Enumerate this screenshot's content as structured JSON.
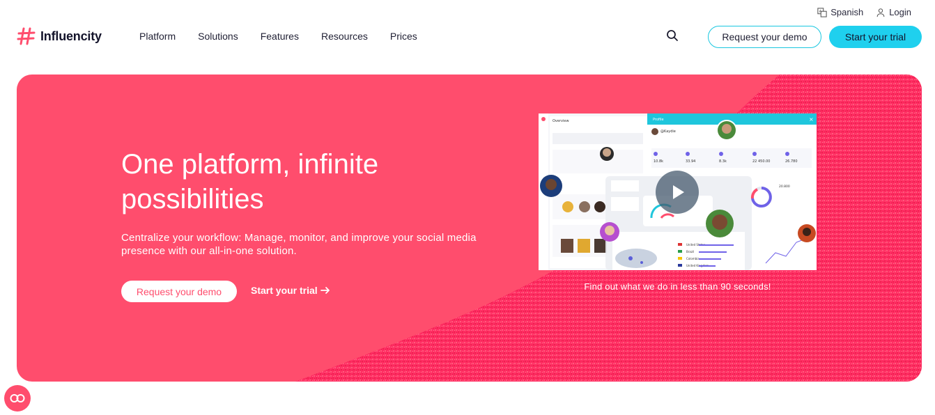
{
  "utility": {
    "language_label": "Spanish",
    "login_label": "Login"
  },
  "brand": {
    "name": "Influencity",
    "accent": "#ff4d6d",
    "cyan": "#1fd0ee"
  },
  "nav": {
    "items": [
      "Platform",
      "Solutions",
      "Features",
      "Resources",
      "Prices"
    ]
  },
  "header_actions": {
    "demo_label": "Request your demo",
    "trial_label": "Start your trial"
  },
  "hero": {
    "title": "One platform, infinite possibilities",
    "subtitle": "Centralize your workflow: Manage, monitor, and improve your social media presence with our all-in-one solution.",
    "demo_label": "Request your demo",
    "trial_label": "Start your trial",
    "video_caption": "Find out what we do in less than 90 seconds!"
  },
  "video_preview": {
    "overview_title": "Overview",
    "profile_title": "Profile",
    "profile_handle": "@Kaydie",
    "stats": [
      "10.8k",
      "33.94",
      "8.3k",
      "22 450.00",
      "26.780"
    ],
    "countries": [
      "United States",
      "Brazil",
      "Colombia",
      "United Kingdom"
    ],
    "chart_value": "20.800"
  },
  "icons": {
    "translate": "translate-icon",
    "user": "user-icon",
    "search": "search-icon",
    "arrow": "arrow-right-icon",
    "play": "play-icon",
    "chat": "chat-icon"
  }
}
